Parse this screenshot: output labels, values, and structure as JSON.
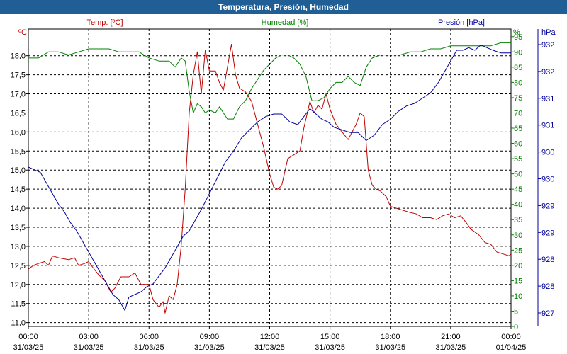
{
  "window": {
    "title": "Temperatura, Presión, Humedad"
  },
  "chart_data": {
    "type": "line",
    "title": "Temperatura, Presión, Humedad",
    "grid": true,
    "x": {
      "range": [
        "31/03/25 00:00",
        "01/04/25 00:00"
      ],
      "tick_labels": [
        {
          "time": "00:00",
          "date": "31/03/25"
        },
        {
          "time": "03:00",
          "date": "31/03/25"
        },
        {
          "time": "06:00",
          "date": "31/03/25"
        },
        {
          "time": "09:00",
          "date": "31/03/25"
        },
        {
          "time": "12:00",
          "date": "31/03/25"
        },
        {
          "time": "15:00",
          "date": "31/03/25"
        },
        {
          "time": "18:00",
          "date": "31/03/25"
        },
        {
          "time": "21:00",
          "date": "31/03/25"
        },
        {
          "time": "00:00",
          "date": "01/04/25"
        }
      ]
    },
    "axes": {
      "temperature": {
        "label": "Temp. [ºC]",
        "unit": "ºC",
        "color": "#c00000",
        "ylim": [
          10.9,
          18.7
        ],
        "ticks": [
          "11,0",
          "11,5",
          "12,0",
          "12,5",
          "13,0",
          "13,5",
          "14,0",
          "14,5",
          "15,0",
          "15,5",
          "16,0",
          "16,5",
          "17,0",
          "17,5",
          "18,0"
        ]
      },
      "humidity": {
        "label": "Humedad [%]",
        "unit": "%",
        "color": "#008000",
        "ylim": [
          0,
          97.5
        ],
        "ticks": [
          "0",
          "5",
          "10",
          "15",
          "20",
          "25",
          "30",
          "35",
          "40",
          "45",
          "50",
          "55",
          "60",
          "65",
          "70",
          "75",
          "80",
          "85",
          "90",
          "95"
        ]
      },
      "pressure": {
        "label": "Presión [hPa]",
        "unit": "hPa",
        "color": "#000099",
        "ylim": [
          926.8,
          932.4
        ],
        "ticks": [
          "927",
          "928",
          "928",
          "929",
          "929",
          "930",
          "930",
          "931",
          "931",
          "932",
          "932"
        ]
      }
    },
    "series": [
      {
        "name": "Temp. [ºC]",
        "axis": "temperature",
        "color": "#c00000",
        "points": [
          [
            0,
            12.4
          ],
          [
            0.25,
            12.5
          ],
          [
            0.5,
            12.55
          ],
          [
            0.8,
            12.6
          ],
          [
            1.0,
            12.5
          ],
          [
            1.2,
            12.75
          ],
          [
            1.5,
            12.7
          ],
          [
            2.0,
            12.65
          ],
          [
            2.3,
            12.7
          ],
          [
            2.5,
            12.5
          ],
          [
            2.8,
            12.55
          ],
          [
            3.0,
            12.6
          ],
          [
            3.2,
            12.45
          ],
          [
            3.5,
            12.25
          ],
          [
            3.8,
            12.1
          ],
          [
            4.1,
            11.8
          ],
          [
            4.3,
            11.9
          ],
          [
            4.6,
            12.2
          ],
          [
            5.0,
            12.2
          ],
          [
            5.3,
            12.3
          ],
          [
            5.6,
            12.0
          ],
          [
            6.0,
            12.0
          ],
          [
            6.2,
            11.6
          ],
          [
            6.5,
            11.4
          ],
          [
            6.7,
            11.55
          ],
          [
            6.8,
            11.25
          ],
          [
            7.0,
            11.7
          ],
          [
            7.2,
            11.6
          ],
          [
            7.4,
            12.0
          ],
          [
            7.6,
            13.0
          ],
          [
            7.8,
            14.5
          ],
          [
            8.0,
            16.5
          ],
          [
            8.2,
            17.5
          ],
          [
            8.4,
            18.1
          ],
          [
            8.6,
            17.0
          ],
          [
            8.8,
            18.15
          ],
          [
            9.0,
            17.6
          ],
          [
            9.3,
            17.6
          ],
          [
            9.5,
            17.3
          ],
          [
            9.7,
            17.1
          ],
          [
            9.9,
            17.7
          ],
          [
            10.1,
            18.3
          ],
          [
            10.3,
            17.5
          ],
          [
            10.5,
            17.15
          ],
          [
            10.8,
            17.05
          ],
          [
            11.1,
            16.8
          ],
          [
            11.4,
            16.2
          ],
          [
            11.7,
            15.6
          ],
          [
            12.0,
            14.9
          ],
          [
            12.2,
            14.55
          ],
          [
            12.4,
            14.5
          ],
          [
            12.6,
            14.6
          ],
          [
            12.9,
            15.3
          ],
          [
            13.2,
            15.4
          ],
          [
            13.5,
            15.5
          ],
          [
            13.7,
            16.1
          ],
          [
            14.0,
            16.8
          ],
          [
            14.2,
            16.5
          ],
          [
            14.4,
            16.7
          ],
          [
            14.6,
            16.6
          ],
          [
            14.8,
            17.0
          ],
          [
            15.0,
            16.6
          ],
          [
            15.3,
            16.2
          ],
          [
            15.6,
            16.0
          ],
          [
            15.9,
            15.8
          ],
          [
            16.1,
            16.0
          ],
          [
            16.3,
            16.2
          ],
          [
            16.5,
            16.5
          ],
          [
            16.7,
            16.4
          ],
          [
            16.9,
            15.0
          ],
          [
            17.1,
            14.6
          ],
          [
            17.3,
            14.5
          ],
          [
            17.5,
            14.45
          ],
          [
            17.8,
            14.3
          ],
          [
            18.0,
            14.05
          ],
          [
            18.3,
            14.0
          ],
          [
            18.6,
            13.95
          ],
          [
            18.9,
            13.9
          ],
          [
            19.3,
            13.85
          ],
          [
            19.6,
            13.75
          ],
          [
            20.0,
            13.75
          ],
          [
            20.3,
            13.7
          ],
          [
            20.6,
            13.8
          ],
          [
            20.9,
            13.85
          ],
          [
            21.2,
            13.75
          ],
          [
            21.5,
            13.8
          ],
          [
            21.8,
            13.6
          ],
          [
            22.0,
            13.45
          ],
          [
            22.4,
            13.3
          ],
          [
            22.7,
            13.1
          ],
          [
            23.0,
            13.05
          ],
          [
            23.3,
            12.85
          ],
          [
            23.6,
            12.8
          ],
          [
            23.9,
            12.75
          ],
          [
            24.0,
            12.8
          ]
        ]
      },
      {
        "name": "Humedad [%]",
        "axis": "humidity",
        "color": "#008000",
        "points": [
          [
            0,
            88
          ],
          [
            0.5,
            88
          ],
          [
            1.0,
            90
          ],
          [
            1.5,
            90
          ],
          [
            2.0,
            89
          ],
          [
            2.5,
            90
          ],
          [
            3.0,
            91
          ],
          [
            3.5,
            91
          ],
          [
            4.0,
            91
          ],
          [
            4.5,
            90
          ],
          [
            5.0,
            90
          ],
          [
            5.5,
            90
          ],
          [
            6.0,
            88
          ],
          [
            6.5,
            87
          ],
          [
            7.0,
            87
          ],
          [
            7.3,
            85
          ],
          [
            7.6,
            88
          ],
          [
            7.8,
            87
          ],
          [
            8.0,
            77
          ],
          [
            8.2,
            70
          ],
          [
            8.4,
            73
          ],
          [
            8.6,
            72
          ],
          [
            8.8,
            70
          ],
          [
            9.0,
            71
          ],
          [
            9.3,
            70
          ],
          [
            9.5,
            72
          ],
          [
            9.7,
            70
          ],
          [
            9.9,
            68
          ],
          [
            10.2,
            68
          ],
          [
            10.5,
            72
          ],
          [
            10.8,
            74
          ],
          [
            11.1,
            78
          ],
          [
            11.4,
            81
          ],
          [
            11.7,
            84
          ],
          [
            12.0,
            86
          ],
          [
            12.3,
            88
          ],
          [
            12.6,
            89
          ],
          [
            12.9,
            89
          ],
          [
            13.2,
            88
          ],
          [
            13.5,
            86
          ],
          [
            13.8,
            82
          ],
          [
            14.1,
            74
          ],
          [
            14.4,
            74
          ],
          [
            14.7,
            75
          ],
          [
            15.0,
            78
          ],
          [
            15.3,
            80
          ],
          [
            15.6,
            80
          ],
          [
            15.9,
            82
          ],
          [
            16.2,
            80
          ],
          [
            16.5,
            79
          ],
          [
            16.8,
            85
          ],
          [
            17.1,
            88
          ],
          [
            17.5,
            89
          ],
          [
            18.0,
            89
          ],
          [
            18.5,
            89
          ],
          [
            19.0,
            90
          ],
          [
            19.5,
            90
          ],
          [
            20.0,
            91
          ],
          [
            20.5,
            91
          ],
          [
            21.0,
            92
          ],
          [
            21.5,
            92
          ],
          [
            22.0,
            92
          ],
          [
            22.5,
            92
          ],
          [
            23.0,
            92
          ],
          [
            23.5,
            93
          ],
          [
            24.0,
            93
          ]
        ]
      },
      {
        "name": "Presión [hPa]",
        "axis": "pressure",
        "color": "#000099",
        "points": [
          [
            0,
            929.8
          ],
          [
            0.3,
            929.75
          ],
          [
            0.6,
            929.7
          ],
          [
            0.9,
            929.5
          ],
          [
            1.2,
            929.3
          ],
          [
            1.5,
            929.1
          ],
          [
            1.8,
            928.95
          ],
          [
            2.1,
            928.75
          ],
          [
            2.4,
            928.6
          ],
          [
            2.7,
            928.4
          ],
          [
            3.0,
            928.2
          ],
          [
            3.3,
            928.0
          ],
          [
            3.6,
            927.8
          ],
          [
            3.9,
            927.6
          ],
          [
            4.2,
            927.4
          ],
          [
            4.5,
            927.3
          ],
          [
            4.8,
            927.1
          ],
          [
            5.0,
            927.35
          ],
          [
            5.3,
            927.4
          ],
          [
            5.6,
            927.45
          ],
          [
            5.9,
            927.55
          ],
          [
            6.2,
            927.6
          ],
          [
            6.5,
            927.75
          ],
          [
            6.8,
            927.9
          ],
          [
            7.1,
            928.1
          ],
          [
            7.4,
            928.3
          ],
          [
            7.7,
            928.5
          ],
          [
            8.0,
            928.6
          ],
          [
            8.3,
            928.8
          ],
          [
            8.6,
            929.0
          ],
          [
            9.0,
            929.3
          ],
          [
            9.4,
            929.6
          ],
          [
            9.8,
            929.9
          ],
          [
            10.2,
            930.1
          ],
          [
            10.6,
            930.35
          ],
          [
            11.0,
            930.5
          ],
          [
            11.4,
            930.65
          ],
          [
            11.8,
            930.75
          ],
          [
            12.2,
            930.8
          ],
          [
            12.6,
            930.8
          ],
          [
            13.0,
            930.65
          ],
          [
            13.4,
            930.6
          ],
          [
            13.7,
            930.75
          ],
          [
            14.0,
            930.9
          ],
          [
            14.3,
            930.8
          ],
          [
            14.6,
            930.7
          ],
          [
            14.9,
            930.65
          ],
          [
            15.2,
            930.55
          ],
          [
            15.6,
            930.5
          ],
          [
            16.0,
            930.45
          ],
          [
            16.4,
            930.45
          ],
          [
            16.8,
            930.3
          ],
          [
            17.2,
            930.4
          ],
          [
            17.6,
            930.6
          ],
          [
            18.0,
            930.7
          ],
          [
            18.4,
            930.85
          ],
          [
            18.8,
            930.95
          ],
          [
            19.2,
            931.0
          ],
          [
            19.6,
            931.1
          ],
          [
            20.0,
            931.2
          ],
          [
            20.4,
            931.4
          ],
          [
            20.7,
            931.6
          ],
          [
            21.0,
            931.8
          ],
          [
            21.3,
            932.0
          ],
          [
            21.6,
            932.0
          ],
          [
            21.9,
            932.05
          ],
          [
            22.2,
            932.0
          ],
          [
            22.5,
            932.1
          ],
          [
            22.8,
            932.05
          ],
          [
            23.1,
            932.0
          ],
          [
            23.5,
            931.95
          ],
          [
            24.0,
            931.95
          ]
        ]
      }
    ]
  }
}
